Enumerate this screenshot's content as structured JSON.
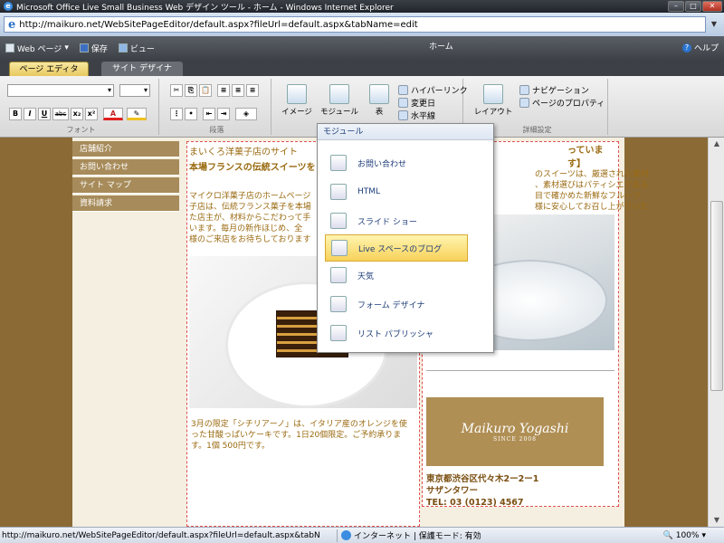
{
  "window": {
    "title": "Microsoft Office Live Small Business Web デザイン ツール - ホーム - Windows Internet Explorer",
    "url": "http://maikuro.net/WebSitePageEditor/default.aspx?fileUrl=default.aspx&tabName=edit"
  },
  "ribbon_top": {
    "web_page": "Web ページ",
    "save": "保存",
    "view": "ビュー",
    "home": "ホーム",
    "help": "ヘルプ"
  },
  "tabs": [
    "ページ エディタ",
    "サイト デザイナ"
  ],
  "ribbon": {
    "font_group": "フォント",
    "paragraph_group": "段落",
    "image": "イメージ",
    "module": "モジュール",
    "table": "表",
    "hyperlink": "ハイパーリンク",
    "updated_date": "変更日",
    "horizontal_line": "水平線",
    "layout": "レイアウト",
    "navigation": "ナビゲーション",
    "page_properties": "ページのプロパティ",
    "details": "詳細設定",
    "bold": "B",
    "italic": "I",
    "underline": "U",
    "strike": "abc",
    "subscript": "x₂",
    "superscript": "x²",
    "font_color": "A"
  },
  "dropdown": {
    "title": "モジュール",
    "items": [
      {
        "label": "お問い合わせ",
        "icon": "contact-icon"
      },
      {
        "label": "HTML",
        "icon": "html-icon"
      },
      {
        "label": "スライド ショー",
        "icon": "slideshow-icon"
      },
      {
        "label": "Live スペースのブログ",
        "icon": "blog-icon"
      },
      {
        "label": "天気",
        "icon": "weather-icon"
      },
      {
        "label": "フォーム デザイナ",
        "icon": "form-icon"
      },
      {
        "label": "リスト パブリッシャ",
        "icon": "list-icon"
      }
    ]
  },
  "leftnav": [
    "店舗紹介",
    "お問い合わせ",
    "サイト マップ",
    "資料請求"
  ],
  "main": {
    "heading": "まいくろ洋菓子店のサイト",
    "subheading": "本場フランスの伝統スイーツを",
    "body_lines": [
      "マイクロ洋菓子店のホームページ",
      "子店は、伝統フランス菓子を本場",
      "た店主が、材料からこだわって手",
      "います。毎月の新作ほじめ、全",
      "様のご来店をお待ちしております"
    ],
    "caption": "3月の限定「シチリアーノ」は、イタリア産のオレンジを使った甘酸っぱいケーキです。1日20個限定。ご予約承ります。1個 500円です。"
  },
  "right": {
    "heading": "っています】",
    "body_lines": [
      "のスイーツは、厳選された素材",
      "、素材選びはパティシエである",
      "目で確かめた新鮮なフルーツ",
      "様に安心してお召し上がりいた"
    ],
    "logo_text": "Maikuro Yogashi",
    "logo_since": "SINCE 2008",
    "address1": "東京都渋谷区代々木2ー2ー1",
    "address2": "サザンタワー",
    "tel": "TEL: 03 (0123) 4567"
  },
  "status": {
    "url": "http://maikuro.net/WebSitePageEditor/default.aspx?fileUrl=default.aspx&tabN",
    "zone": "インターネット | 保護モード: 有効",
    "zoom": "100%"
  }
}
